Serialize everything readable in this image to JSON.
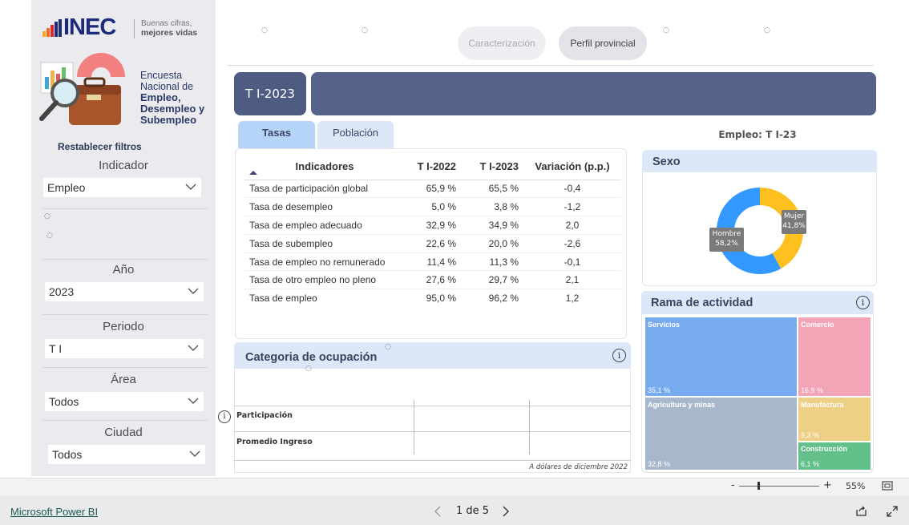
{
  "brand": {
    "name": "INEC",
    "tagline1": "Buenas cifras,",
    "tagline2": "mejores vidas"
  },
  "survey": {
    "line1": "Encuesta",
    "line2": "Nacional de",
    "line3": "Empleo,",
    "line4": "Desempleo y",
    "line5": "Subempleo"
  },
  "filters": {
    "reset": "Restablecer filtros",
    "indicador": {
      "label": "Indicador",
      "value": "Empleo"
    },
    "anio": {
      "label": "Año",
      "value": "2023"
    },
    "periodo": {
      "label": "Periodo",
      "value": "T I"
    },
    "area": {
      "label": "Área",
      "value": "Todos"
    },
    "ciudad": {
      "label": "Ciudad",
      "value": "Todos"
    }
  },
  "nav": {
    "caracterizacion": "Caracterización",
    "perfil": "Perfil provincial"
  },
  "period_title": "T I-2023",
  "tabs": {
    "tasas": "Tasas",
    "poblacion": "Población"
  },
  "employment_label": "Empleo: T I-23",
  "table": {
    "headers": [
      "Indicadores",
      "T I-2022",
      "T I-2023",
      "Variación (p.p.)"
    ],
    "rows": [
      [
        "Tasa de participación global",
        "65,9 %",
        "65,5 %",
        "-0,4"
      ],
      [
        "Tasa de desempleo",
        "5,0 %",
        "3,8 %",
        "-1,2"
      ],
      [
        "Tasa de empleo adecuado",
        "32,9 %",
        "34,9 %",
        "2,0"
      ],
      [
        "Tasa de subempleo",
        "22,6 %",
        "20,0 %",
        "-2,6"
      ],
      [
        "Tasa de empleo no remunerado",
        "11,4 %",
        "11,3 %",
        "-0,1"
      ],
      [
        "Tasa de otro empleo no pleno",
        "27,6 %",
        "29,7 %",
        "2,1"
      ],
      [
        "Tasa de empleo",
        "95,0 %",
        "96,2 %",
        "1,2"
      ]
    ]
  },
  "sexo": {
    "title": "Sexo",
    "hombre_label": "Hombre",
    "hombre_value": "58,2%",
    "mujer_label": "Mujer",
    "mujer_value": "41,8%",
    "hombre_pct": 58.2,
    "mujer_pct": 41.8,
    "colors": {
      "hombre": "#3399ff",
      "mujer": "#ffbf1f"
    }
  },
  "rama": {
    "title": "Rama de actividad",
    "items": [
      {
        "name": "Servicios",
        "value": "35,1 %",
        "color": "#78aaf0"
      },
      {
        "name": "Agricultura y minas",
        "value": "32,8 %",
        "color": "#a8b8cc"
      },
      {
        "name": "Comercio",
        "value": "16,9 %",
        "color": "#f3a5b8"
      },
      {
        "name": "Manufactura",
        "value": "9,3 %",
        "color": "#eecf86"
      },
      {
        "name": "Construcción",
        "value": "6,1 %",
        "color": "#64c08a"
      }
    ]
  },
  "categoria": {
    "title": "Categoria de ocupación",
    "row1": "Participación",
    "row2": "Promedio Ingreso",
    "note": "A dólares de diciembre 2022"
  },
  "status": {
    "zoom": "55%",
    "minus": "-",
    "plus": "+"
  },
  "footer": {
    "powerbi": "Microsoft Power BI",
    "page": "1 de 5"
  }
}
